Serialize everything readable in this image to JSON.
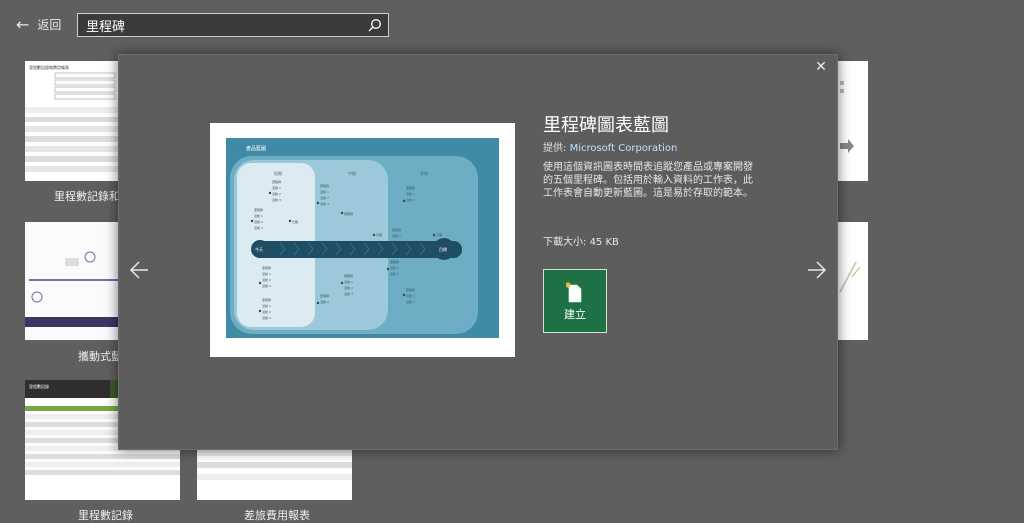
{
  "header": {
    "back_label": "返回",
    "search_value": "里程碑"
  },
  "gallery": {
    "items": [
      {
        "label": "里程數記錄和費"
      },
      {
        "label": "攜動式藍圖"
      },
      {
        "label": "里程數記錄"
      },
      {
        "label": "差旅費用報表"
      }
    ],
    "thumb1_title": "里程數記錄和費用報表",
    "thumb3_title": "里程數記錄"
  },
  "modal": {
    "title": "里程碑圖表藍圖",
    "provider_label": "提供:",
    "provider_name": "Microsoft Corporation",
    "description": "使用這個資訊圖表時間表追蹤您產品或專案開發的五個里程碑。包括用於輸入資料的工作表，此工作表會自動更新藍圖。這是易於存取的範本。",
    "download_label": "下載大小:",
    "download_size": "45 KB",
    "create_label": "建立"
  },
  "preview": {
    "title": "產品藍圖",
    "phases": [
      "短期",
      "中期",
      "長期"
    ],
    "start_label": "今天",
    "end_label": "目標",
    "milestone_label": "里程碑",
    "milestone_label_alt": "日期",
    "activity_lines": [
      "里程碑",
      "活動 1",
      "活動 2",
      "活動 3"
    ],
    "colors": {
      "bg": "#3f8ba6",
      "mid": "#89bfd3",
      "inner": "#b7d8e5",
      "core": "#e4eff4",
      "arrow": "#1f4d63"
    }
  }
}
